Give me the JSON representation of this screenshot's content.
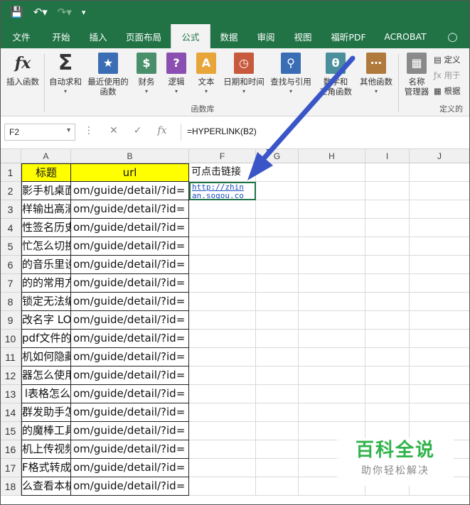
{
  "colors": {
    "excel_green": "#217346",
    "header_fill": "#ffff00",
    "link": "#1a4fbf",
    "arrow": "#3a55c8",
    "watermark": "#30b34b"
  },
  "quick_access": {
    "save_icon": "save-icon",
    "undo_icon": "undo-icon",
    "redo_icon": "redo-icon",
    "customize_icon": "customize-icon"
  },
  "tabs": [
    "文件",
    "开始",
    "插入",
    "页面布局",
    "公式",
    "数据",
    "审阅",
    "视图",
    "福昕PDF",
    "ACROBAT"
  ],
  "active_tab": "公式",
  "ribbon": {
    "insert_function": "插入函数",
    "autosum": "自动求和",
    "recent_1": "最近使用的",
    "recent_2": "函数",
    "financial": "财务",
    "logical": "逻辑",
    "text": "文本",
    "datetime": "日期和时间",
    "lookup": "查找与引用",
    "math_1": "数学和",
    "math_2": "三角函数",
    "other": "其他函数",
    "name_mgr_1": "名称",
    "name_mgr_2": "管理器",
    "define_name": "定义",
    "use_in_formula": "用于",
    "create_from": "根据",
    "group_function_library": "函数库",
    "group_defined_names": "定义的"
  },
  "formula_bar": {
    "name_box": "F2",
    "formula": "=HYPERLINK(B2)"
  },
  "columns": [
    "A",
    "B",
    "F",
    "G",
    "H",
    "I",
    "J"
  ],
  "sheet": {
    "a_header": "标题",
    "b_header": "url",
    "f_header": "可点击链接",
    "f2_line1": "http://zhin",
    "f2_line2": "an.sogou.co",
    "rows": [
      {
        "n": "1"
      },
      {
        "n": "2",
        "a": "影手机桌面",
        "b": "om/guide/detail/?id="
      },
      {
        "n": "3",
        "a": "样输出高清",
        "b": "om/guide/detail/?id="
      },
      {
        "n": "4",
        "a": "性签名历史",
        "b": "om/guide/detail/?id="
      },
      {
        "n": "5",
        "a": "忙怎么切换",
        "b": "om/guide/detail/?id="
      },
      {
        "n": "6",
        "a": "的音乐里设",
        "b": "om/guide/detail/?id="
      },
      {
        "n": "7",
        "a": "的的常用方",
        "b": "om/guide/detail/?id="
      },
      {
        "n": "8",
        "a": "锁定无法编",
        "b": "om/guide/detail/?id="
      },
      {
        "n": "9",
        "a": "改名字 LOL",
        "b": "om/guide/detail/?id="
      },
      {
        "n": "10",
        "a": "pdf文件的",
        "b": "om/guide/detail/?id="
      },
      {
        "n": "11",
        "a": "机如何隐藏",
        "b": "om/guide/detail/?id="
      },
      {
        "n": "12",
        "a": "器怎么使用",
        "b": "om/guide/detail/?id="
      },
      {
        "n": "13",
        "a": "l表格怎么",
        "b": "om/guide/detail/?id="
      },
      {
        "n": "14",
        "a": "群发助手怎",
        "b": "om/guide/detail/?id="
      },
      {
        "n": "15",
        "a": "的魔棒工具",
        "b": "om/guide/detail/?id="
      },
      {
        "n": "16",
        "a": "机上传视频",
        "b": "om/guide/detail/?id="
      },
      {
        "n": "17",
        "a": "F格式转成",
        "b": "om/guide/detail/?id="
      },
      {
        "n": "18",
        "a": "么查看本机",
        "b": "om/guide/detail/?id="
      }
    ]
  }
}
